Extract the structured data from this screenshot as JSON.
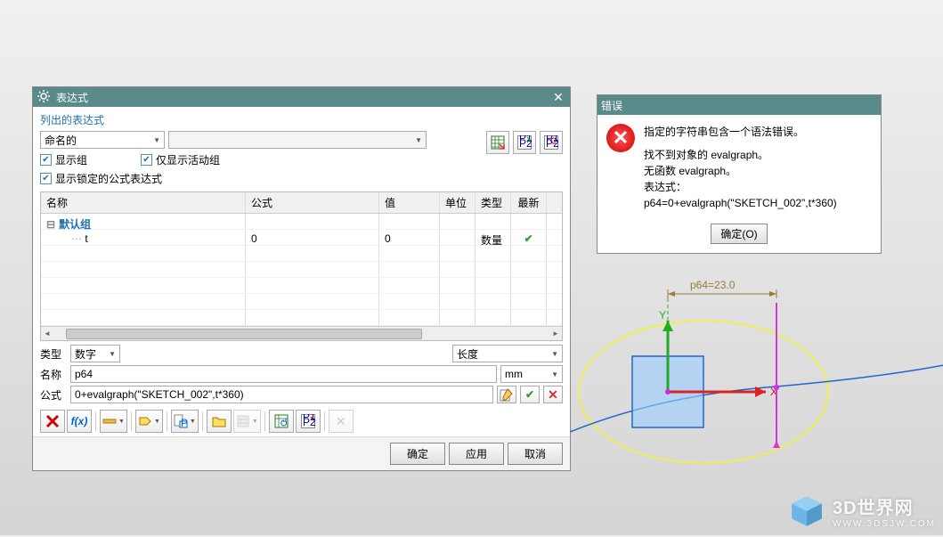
{
  "dialog": {
    "title": "表达式",
    "section": "列出的表达式",
    "dd_named": "命名的",
    "chk_show_group": "显示组",
    "chk_only_active": "仅显示活动组",
    "chk_show_locked": "显示锁定的公式表达式",
    "table": {
      "headers": {
        "name": "名称",
        "formula": "公式",
        "value": "值",
        "unit": "单位",
        "type": "类型",
        "latest": "最新"
      },
      "group": "默认组",
      "rows": [
        {
          "name": "t",
          "formula": "0",
          "value": "0",
          "unit": "",
          "type": "数量",
          "latest": "✔"
        }
      ]
    },
    "form": {
      "type_lbl": "类型",
      "type_val": "数字",
      "length_val": "长度",
      "name_lbl": "名称",
      "name_val": "p64",
      "unit_val": "mm",
      "formula_lbl": "公式",
      "formula_val": "0+evalgraph(\"SKETCH_002\",t*360)"
    },
    "footer": {
      "ok": "确定",
      "apply": "应用",
      "cancel": "取消"
    }
  },
  "error": {
    "title": "错误",
    "line1": "指定的字符串包含一个语法错误。",
    "line2": "找不到对象的 evalgraph。",
    "line3": "无函数 evalgraph。",
    "line4": "表达式：",
    "line5": "p64=0+evalgraph(\"SKETCH_002\",t*360)",
    "ok": "确定(O)"
  },
  "sketch": {
    "dim_label": "p64=23.0"
  },
  "watermark": {
    "name": "3D世界网",
    "url": "WWW.3DSJW.COM"
  }
}
